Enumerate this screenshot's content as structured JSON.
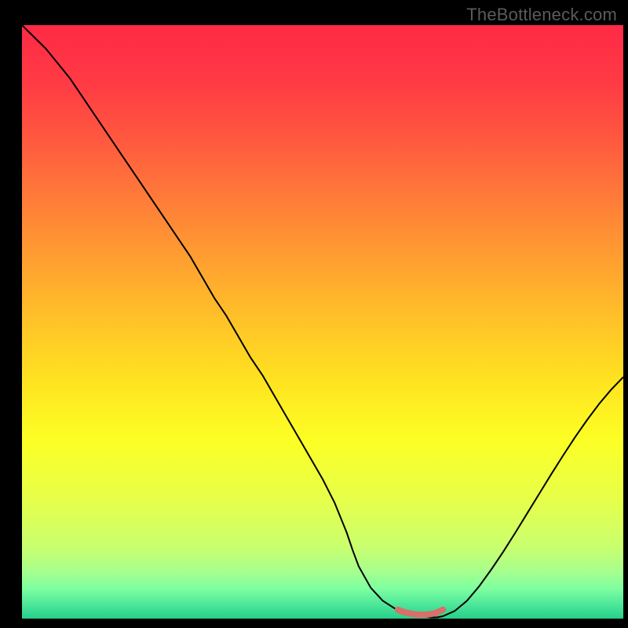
{
  "watermark": "TheBottleneck.com",
  "chart_data": {
    "type": "line",
    "title": "",
    "xlabel": "",
    "ylabel": "",
    "xlim": [
      0,
      100
    ],
    "ylim": [
      0,
      100
    ],
    "background": {
      "gradient_stops": [
        {
          "offset": 0.0,
          "color": "#ff2a46"
        },
        {
          "offset": 0.1,
          "color": "#ff3b44"
        },
        {
          "offset": 0.2,
          "color": "#ff5b3f"
        },
        {
          "offset": 0.3,
          "color": "#ff7e38"
        },
        {
          "offset": 0.4,
          "color": "#ffa130"
        },
        {
          "offset": 0.5,
          "color": "#ffc328"
        },
        {
          "offset": 0.6,
          "color": "#ffe320"
        },
        {
          "offset": 0.7,
          "color": "#fcff25"
        },
        {
          "offset": 0.8,
          "color": "#e6ff4a"
        },
        {
          "offset": 0.88,
          "color": "#c9ff6f"
        },
        {
          "offset": 0.92,
          "color": "#a7ff8d"
        },
        {
          "offset": 0.95,
          "color": "#7dffa0"
        },
        {
          "offset": 0.975,
          "color": "#4fe89a"
        },
        {
          "offset": 1.0,
          "color": "#26cf8a"
        }
      ]
    },
    "series": [
      {
        "name": "bottleneck-curve",
        "color": "#000000",
        "width": 2,
        "x": [
          0,
          2,
          4,
          6,
          8,
          10,
          12,
          14,
          16,
          18,
          20,
          22,
          24,
          26,
          28,
          30,
          32,
          34,
          36,
          38,
          40,
          42,
          44,
          46,
          48,
          50,
          52,
          54,
          55,
          56,
          58,
          60,
          62,
          64,
          66,
          68,
          69,
          70,
          72,
          74,
          76,
          78,
          80,
          82,
          84,
          86,
          88,
          90,
          92,
          94,
          96,
          98,
          100
        ],
        "y": [
          100,
          98,
          96,
          93.5,
          91,
          88,
          85,
          82,
          79,
          76,
          73,
          70,
          67,
          64,
          61,
          57.5,
          54,
          51,
          47.5,
          44,
          41,
          37.5,
          34,
          30.5,
          27,
          23.5,
          19.5,
          14.5,
          11.5,
          8.8,
          5.2,
          3.0,
          1.7,
          0.9,
          0.4,
          0.2,
          0.2,
          0.4,
          1.3,
          3.0,
          5.4,
          8.2,
          11.2,
          14.4,
          17.7,
          21.0,
          24.3,
          27.5,
          30.6,
          33.5,
          36.2,
          38.6,
          40.7
        ]
      },
      {
        "name": "valley-highlight",
        "color": "#d86f6b",
        "width": 8,
        "cap": "round",
        "x": [
          62.5,
          63.5,
          64.5,
          65.5,
          66.5,
          67.5,
          68.5,
          69.2,
          70.0
        ],
        "y": [
          1.5,
          1.1,
          0.85,
          0.7,
          0.65,
          0.7,
          0.85,
          1.1,
          1.5
        ]
      }
    ]
  }
}
